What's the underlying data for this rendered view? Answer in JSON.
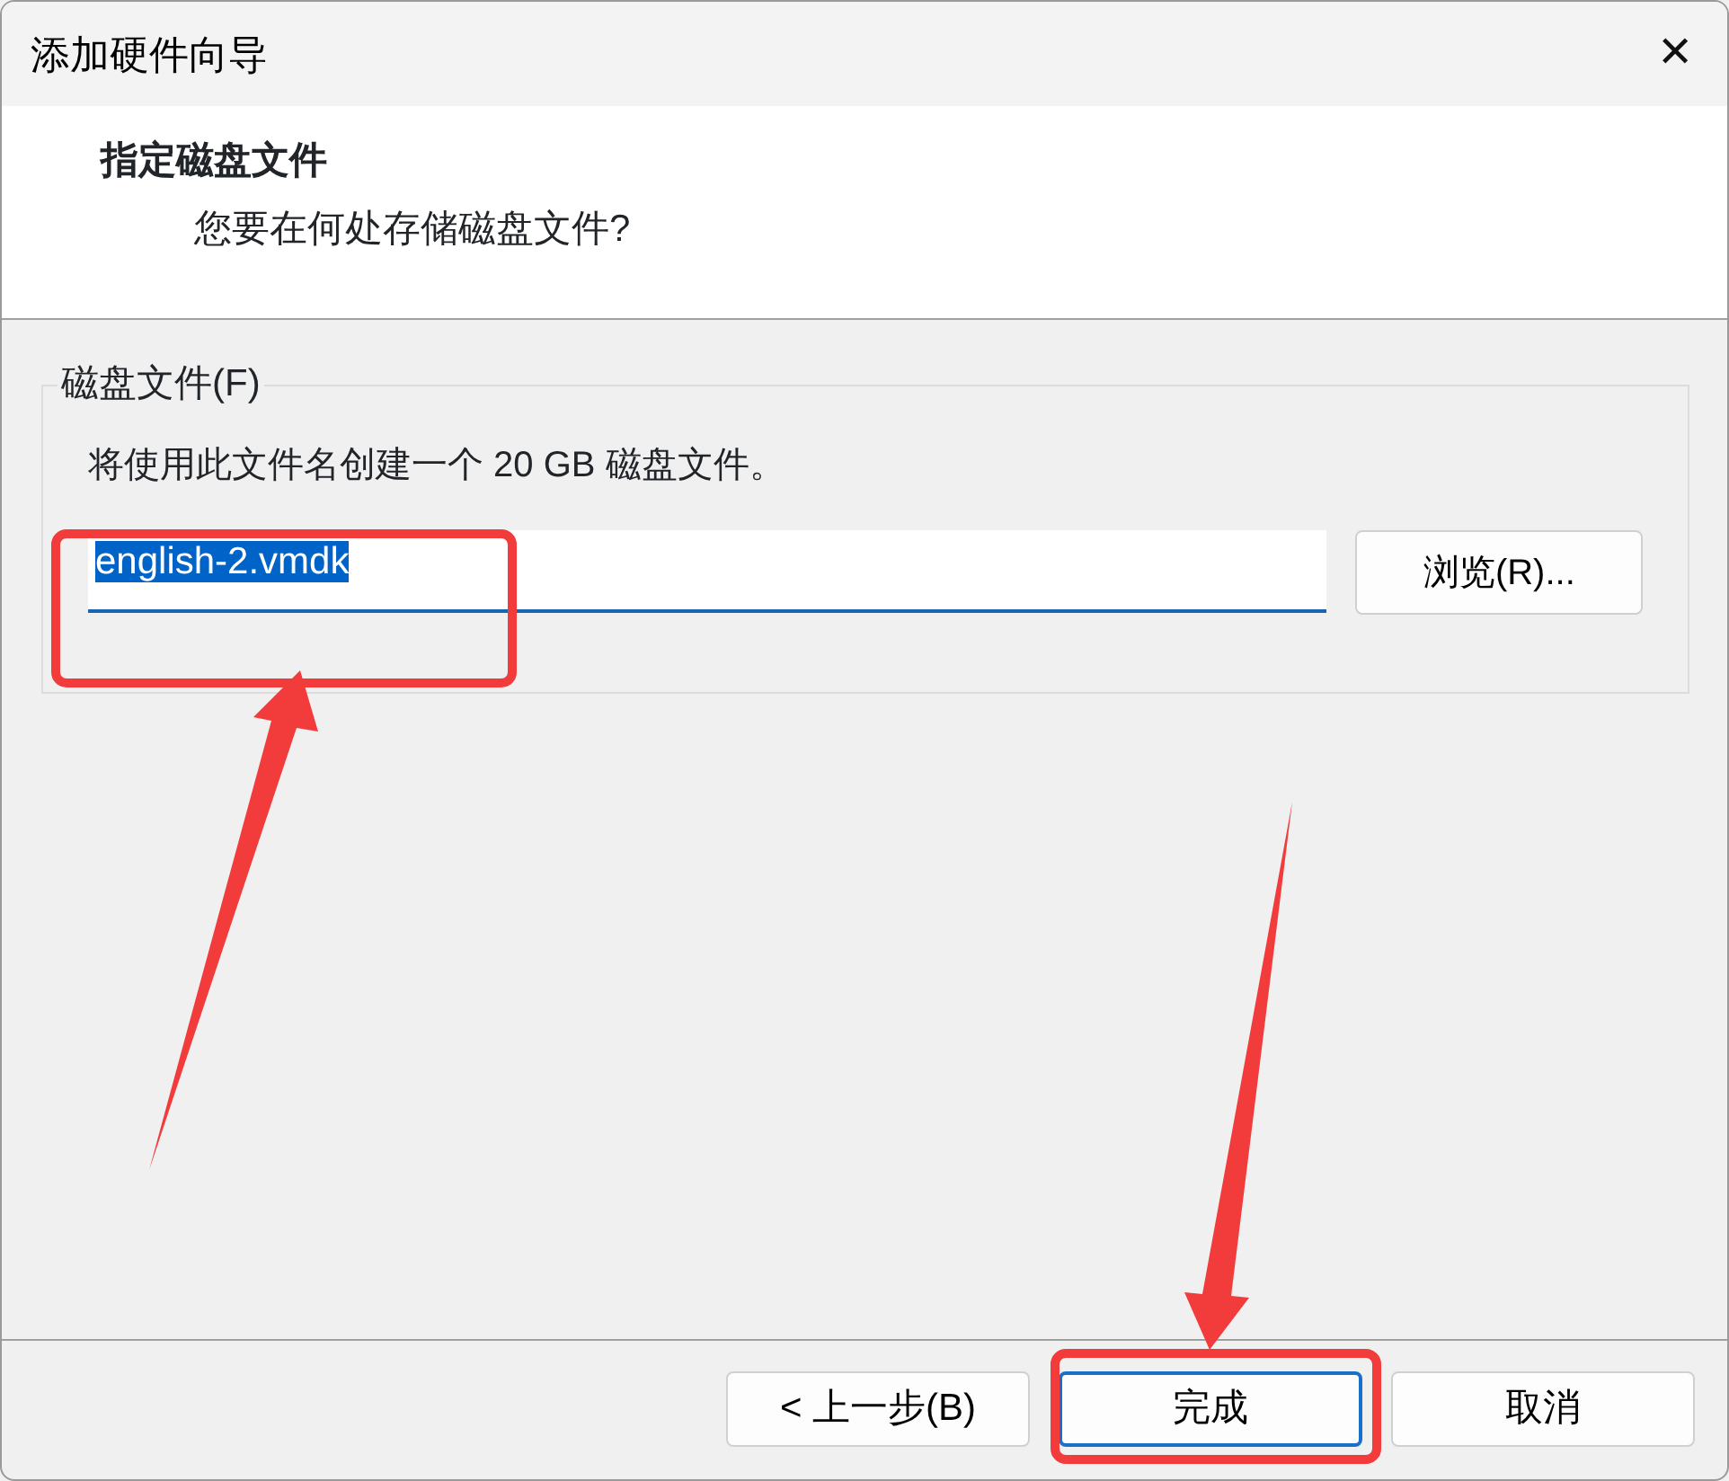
{
  "window": {
    "title": "添加硬件向导",
    "close_glyph": "✕"
  },
  "header": {
    "title": "指定磁盘文件",
    "subtitle": "您要在何处存储磁盘文件?"
  },
  "group": {
    "legend": "磁盘文件(F)",
    "description": "将使用此文件名创建一个 20 GB 磁盘文件。",
    "field": {
      "value": "english-2.vmdk",
      "text_selected": true
    },
    "browse_button": "浏览(R)..."
  },
  "buttons": [
    {
      "label": "< 上一步(B)",
      "default": false
    },
    {
      "label": "完成",
      "default": true
    },
    {
      "label": "取消",
      "default": false
    }
  ]
}
